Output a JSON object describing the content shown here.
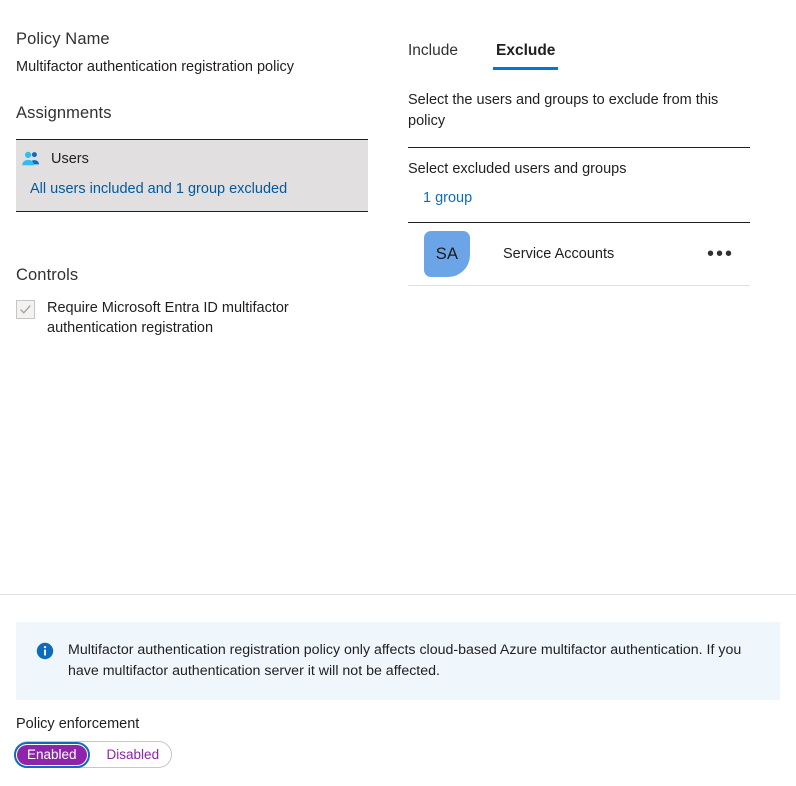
{
  "left": {
    "policy_name_label": "Policy Name",
    "policy_name_value": "Multifactor authentication registration policy",
    "assignments_label": "Assignments",
    "users_card": {
      "icon": "users-group-icon",
      "title": "Users",
      "summary": "All users included and 1 group excluded"
    },
    "controls_label": "Controls",
    "control": {
      "label": "Require Microsoft Entra ID multifactor authentication registration",
      "checked": true,
      "enabled": false,
      "checkmark": "✓"
    }
  },
  "right": {
    "tabs": [
      {
        "label": "Include",
        "active": false
      },
      {
        "label": "Exclude",
        "active": true
      }
    ],
    "description": "Select the users and groups to exclude from this policy",
    "select_label": "Select excluded users and groups",
    "group_count": "1 group",
    "members": [
      {
        "initials": "SA",
        "name": "Service Accounts",
        "avatar_color": "#6ba5e7",
        "menu_glyph": "•••"
      }
    ]
  },
  "banner": {
    "icon": "info-circle-icon",
    "text": "Multifactor authentication registration policy only affects cloud-based Azure multifactor authentication. If you have multifactor authentication server it will not be affected.",
    "background": "#eff6fc",
    "icon_color": "#0f6cbd"
  },
  "enforcement": {
    "label": "Policy enforcement",
    "options": [
      {
        "label": "Enabled",
        "selected": true
      },
      {
        "label": "Disabled",
        "selected": false
      }
    ],
    "selected_color": "#8e24aa",
    "focus_ring_color": "#0f6cbd"
  },
  "accent": {
    "tab_underline": "#0078d4",
    "link": "#0f6cbd",
    "summary_link": "#005a9e"
  }
}
